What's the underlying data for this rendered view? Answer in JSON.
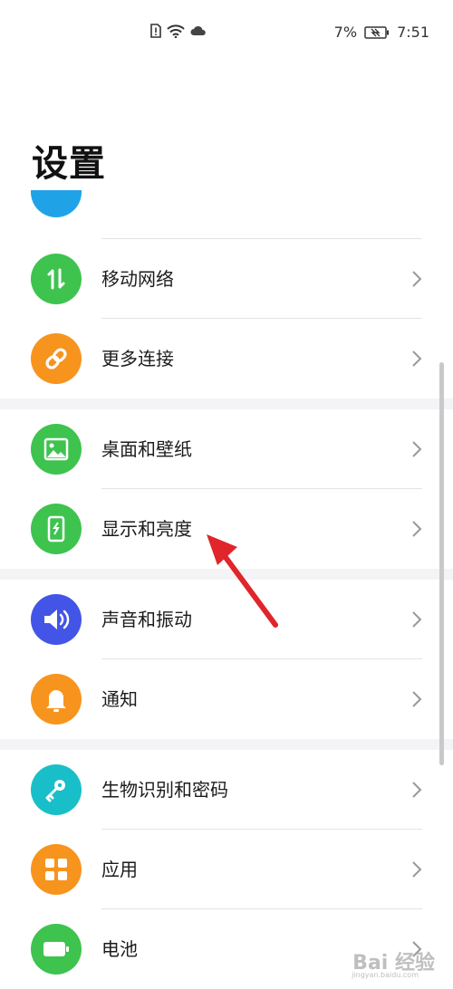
{
  "status_bar": {
    "icons": [
      "sim-alert-icon",
      "wifi-icon",
      "cloud-icon"
    ],
    "battery_percent": "7%",
    "time": "7:51"
  },
  "page_title": "设置",
  "items": [
    {
      "id": "mobile",
      "label": "移动网络",
      "icon": "mobile-data-icon",
      "color": "#3ec34f"
    },
    {
      "id": "more",
      "label": "更多连接",
      "icon": "link-icon",
      "color": "#f7941d"
    },
    {
      "id": "wallpaper",
      "label": "桌面和壁纸",
      "icon": "image-icon",
      "color": "#3ec34f"
    },
    {
      "id": "display",
      "label": "显示和亮度",
      "icon": "display-icon",
      "color": "#3ec34f"
    },
    {
      "id": "sound",
      "label": "声音和振动",
      "icon": "speaker-icon",
      "color": "#4355e6"
    },
    {
      "id": "notify",
      "label": "通知",
      "icon": "bell-icon",
      "color": "#f7941d"
    },
    {
      "id": "bio",
      "label": "生物识别和密码",
      "icon": "key-icon",
      "color": "#18bfc9"
    },
    {
      "id": "apps",
      "label": "应用",
      "icon": "grid-icon",
      "color": "#f7941d"
    },
    {
      "id": "battery",
      "label": "电池",
      "icon": "battery-icon",
      "color": "#3ec34f"
    }
  ],
  "partial_top_item_color": "#1fa3e6",
  "watermark": "Bai 经验",
  "watermark_sub": "jingyan.baidu.com"
}
